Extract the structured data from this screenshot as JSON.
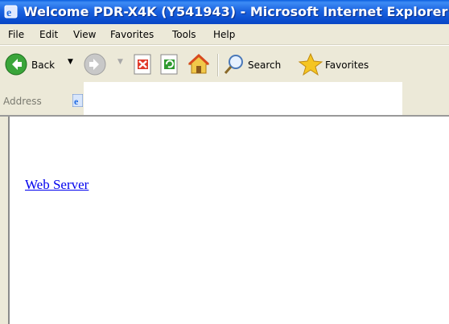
{
  "window": {
    "title": "Welcome PDR-X4K (Y541943) - Microsoft Internet Explorer"
  },
  "menu": [
    "File",
    "Edit",
    "View",
    "Favorites",
    "Tools",
    "Help"
  ],
  "toolbar": {
    "back_label": "Back",
    "search_label": "Search",
    "favorites_label": "Favorites"
  },
  "address": {
    "label": "Address",
    "value": ""
  },
  "page": {
    "link_text": "Web Server"
  },
  "colors": {
    "titlebar": "#0b4fd0",
    "link": "#0000ee",
    "chrome": "#ece9d8"
  }
}
